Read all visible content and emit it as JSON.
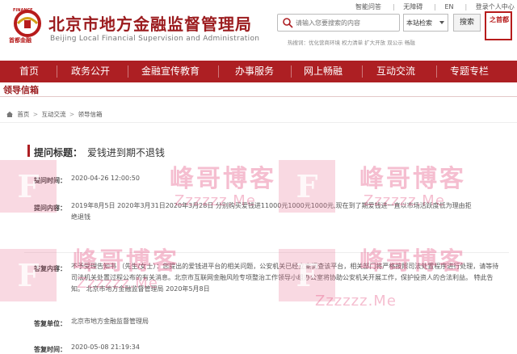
{
  "header": {
    "logo_cn": "北京市地方金融监督管理局",
    "logo_en": "Beijing Local Financial Supervision and Administration",
    "logo_badge_text": "首都金融",
    "logo_badge_small": "FINANCE",
    "top_links": [
      "智能问答",
      "无障碍",
      "EN",
      "登录个人中心"
    ],
    "search_placeholder": "请输入您要搜索的内容",
    "search_scope": "本站检索",
    "search_button": "搜索",
    "hot_search": "热搜词：优化营商环境 权力清单 扩大开放 双公示 畅融",
    "emblem_text": "之首都"
  },
  "nav": {
    "items": [
      "首页",
      "政务公开",
      "金融宣传教育",
      "办事服务",
      "网上畅融",
      "互动交流",
      "专题专栏"
    ]
  },
  "section": {
    "title": "领导信箱"
  },
  "breadcrumb": [
    "首页",
    "互动交流",
    "领导信箱"
  ],
  "letter": {
    "title_label": "提问标题：",
    "title": "爱钱进到期不退钱",
    "time_label": "提问时间：",
    "time": "2020-04-26 12:00:50",
    "content_label": "提问内容：",
    "content": "2019年8月5日 2020年3月31日2020年3月28日 分别购买爱钱进11000元1000元1000元,现在到了期爱钱进一直以市场活跃度低为理由拒绝退钱",
    "reply_label": "答复内容：",
    "reply": "不予受理告知书 （先生/女士）：您提出的爱钱进平台的相关问题，公安机关已经立案调查该平台，相关部门将严格按照司法处置程序进行处理，请等待司法机关处置过程公布的有关消息。北京市互联网金融风险专项整治工作领导小组办公室将协助公安机关开展工作，保护投资人的合法利益。 特此告知。 北京市地方金融监督管理局 2020年5月8日",
    "unit_label": "答复单位：",
    "unit": "北京市地方金融监督管理局",
    "reply_time_label": "答复时间：",
    "reply_time": "2020-05-08 21:19:34"
  },
  "watermark": {
    "letter": "F",
    "text": "峰哥博客",
    "url": "Zzzzzz.Me"
  },
  "colors": {
    "brand_red": "#ad1f23",
    "watermark_pink": "#e14678"
  }
}
